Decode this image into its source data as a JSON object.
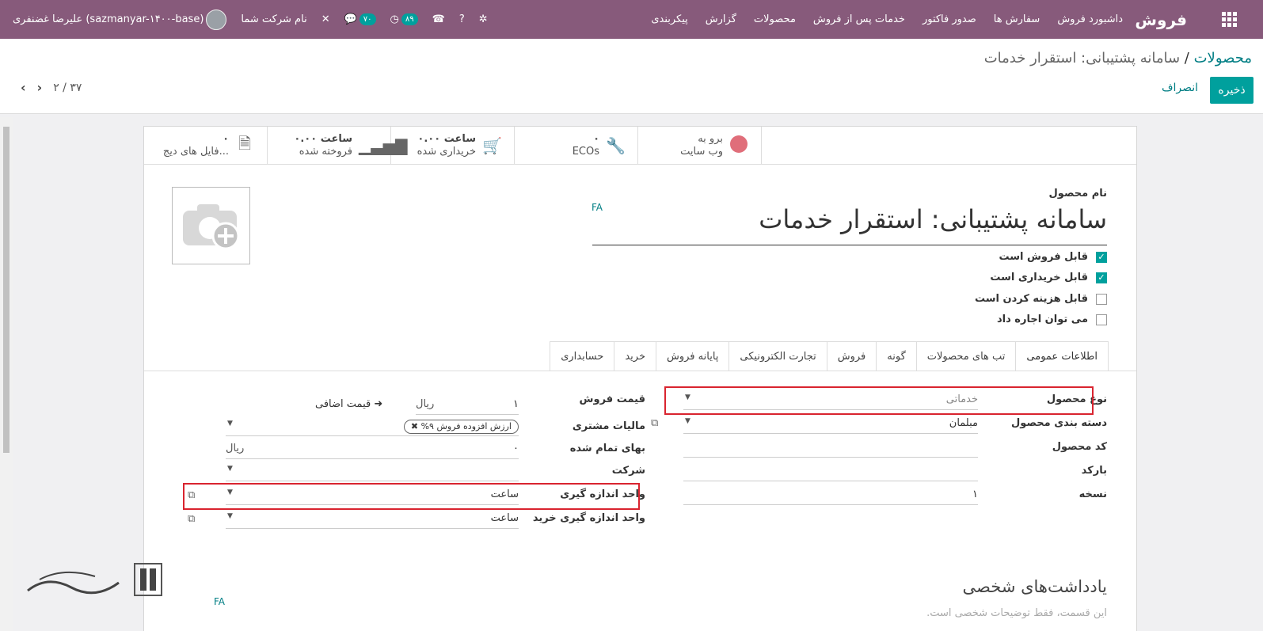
{
  "topbar": {
    "app_name": "فروش",
    "menu": [
      "داشبورد فروش",
      "سفارش ها",
      "صدور فاکتور",
      "خدمات پس از فروش",
      "محصولات",
      "گزارش",
      "پیکربندی"
    ],
    "company": "نام شرکت شما",
    "user": "علیرضا غضنفری (sazmanyar-۱۴۰۰-base)",
    "activity_count": "۸۹",
    "messages_count": "۷۰",
    "bg_color": "#875a7b"
  },
  "breadcrumb": {
    "parent": "محصولات",
    "separator": "/",
    "current": "سامانه پشتیبانی: استقرار خدمات"
  },
  "actions": {
    "save": "ذخیره",
    "discard": "انصراف"
  },
  "pager": {
    "text": "۲ / ۳۷"
  },
  "smart_buttons": {
    "files": {
      "value": "۰",
      "label": "فایل های دیج..."
    },
    "sold": {
      "value": "۰.۰۰ ساعت",
      "label": "فروخته شده"
    },
    "purchased": {
      "value": "۰.۰۰ ساعت",
      "label": "خریداری شده"
    },
    "ecos": {
      "value": "۰",
      "label": "ECOs"
    },
    "website": {
      "line1": "برو به",
      "line2": "وب سایت"
    }
  },
  "product": {
    "name_label": "نام محصول",
    "lang": "FA",
    "name": "سامانه پشتیبانی: استقرار خدمات",
    "checkboxes": [
      {
        "label": "قابل فروش است",
        "checked": true
      },
      {
        "label": "قابل خریداری است",
        "checked": true
      },
      {
        "label": "قابل هزینه کردن است",
        "checked": false
      },
      {
        "label": "می توان اجاره داد",
        "checked": false
      }
    ]
  },
  "tabs": [
    "اطلاعات عمومی",
    "تب های محصولات",
    "گونه",
    "فروش",
    "تجارت الکترونیکی",
    "پایانه فروش",
    "خرید",
    "حسابداری"
  ],
  "general": {
    "product_type_label": "نوع محصول",
    "product_type": "خدماتی",
    "category_label": "دسته بندی محصول",
    "category": "مبلمان",
    "code_label": "کد محصول",
    "barcode_label": "بارکد",
    "version_label": "نسخه",
    "version": "۱",
    "sale_price_label": "قیمت فروش",
    "sale_price": "۱",
    "currency": "ریال",
    "extra_price": "قیمت اضافی",
    "tax_label": "مالیات مشتری",
    "tax_tag": "ارزش افزوده فروش ۹%",
    "cost_label": "بهای تمام شده",
    "cost": "۰",
    "company_label": "شرکت",
    "uom_label": "واحد اندازه گیری",
    "uom": "ساعت",
    "purchase_uom_label": "واحد اندازه گیری خرید",
    "purchase_uom": "ساعت"
  },
  "notes": {
    "title": "یادداشت‌های شخصی",
    "placeholder": "این قسمت، فقط توضیحات شخصی است.",
    "lang": "FA"
  }
}
